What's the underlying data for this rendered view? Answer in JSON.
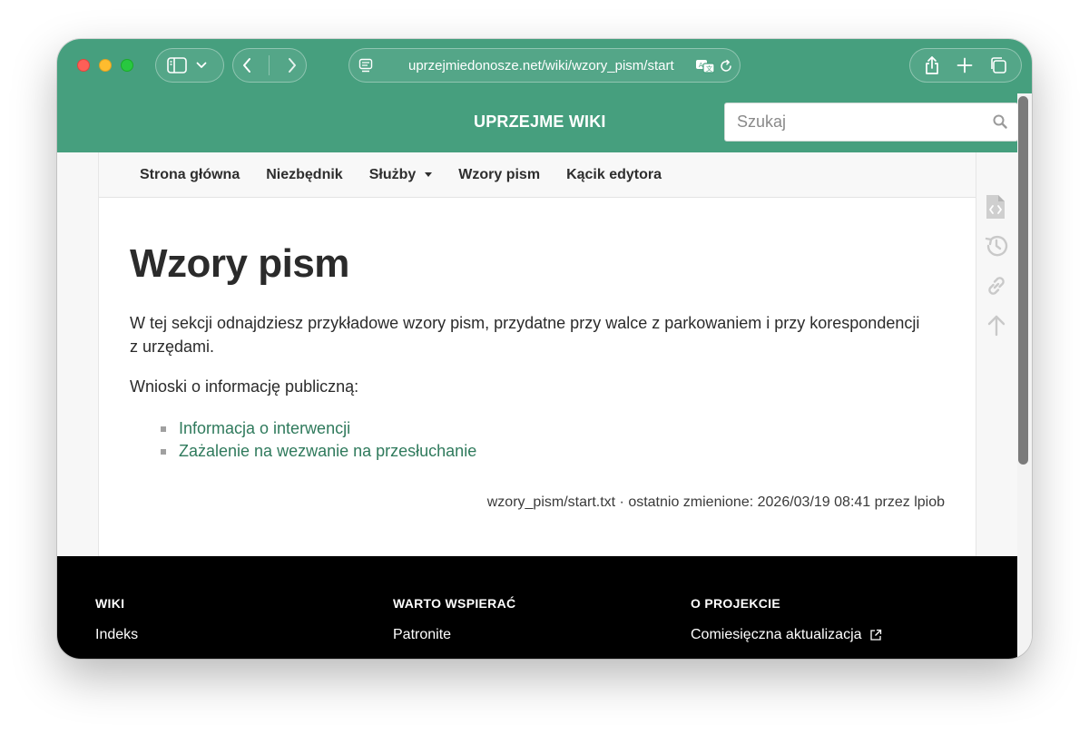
{
  "browser": {
    "url": "uprzejmiedonosze.net/wiki/wzory_pism/start"
  },
  "site": {
    "title": "UPRZEJME WIKI",
    "search_placeholder": "Szukaj"
  },
  "nav": {
    "items": [
      {
        "label": "Strona główna"
      },
      {
        "label": "Niezbędnik"
      },
      {
        "label": "Służby"
      },
      {
        "label": "Wzory pism"
      },
      {
        "label": "Kącik edytora"
      }
    ]
  },
  "page": {
    "title": "Wzory pism",
    "intro": "W tej sekcji odnajdziesz przykładowe wzory pism, przydatne przy walce z parkowaniem i przy korespondencji z urzędami.",
    "section_label": "Wnioski o informację publiczną:",
    "links": [
      {
        "label": "Informacja o interwencji"
      },
      {
        "label": "Zażalenie na wezwanie na przesłuchanie"
      }
    ],
    "meta": "wzory_pism/start.txt · ostatnio zmienione: 2026/03/19 08:41 przez lpiob"
  },
  "footer": {
    "columns": [
      {
        "heading": "WIKI",
        "link": "Indeks"
      },
      {
        "heading": "WARTO WSPIERAĆ",
        "link": "Patronite"
      },
      {
        "heading": "O PROJEKCIE",
        "link": "Comiesięczna aktualizacja"
      }
    ]
  },
  "colors": {
    "brand_green": "#469f7e",
    "link_green": "#2f7a5c",
    "footer_bg": "#000000"
  },
  "icons": {
    "toolbar": [
      "sidebar-icon",
      "chevron-down-icon",
      "back-icon",
      "forward-icon",
      "page-icon",
      "translate-icon",
      "reload-icon",
      "share-icon",
      "plus-icon",
      "tabs-icon"
    ],
    "side_tools": [
      "source-icon",
      "history-icon",
      "link-icon",
      "arrow-up-icon"
    ]
  }
}
